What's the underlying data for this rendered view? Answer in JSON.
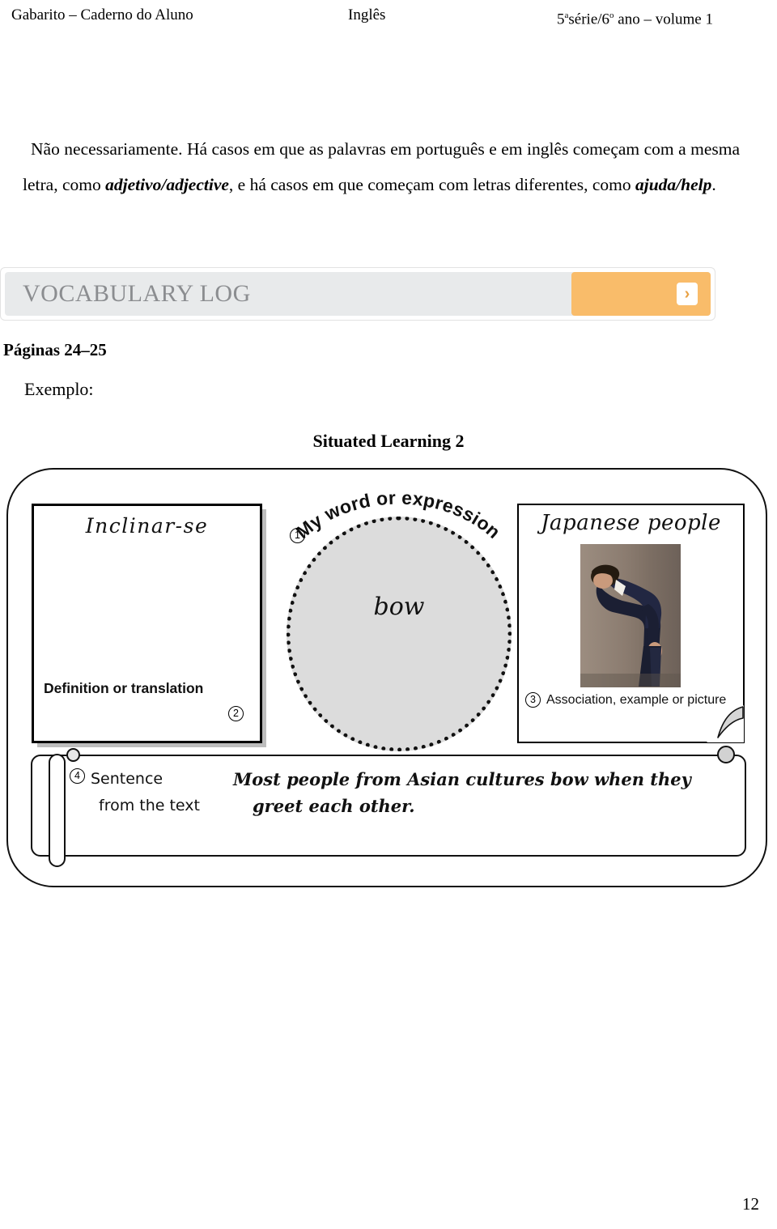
{
  "header": {
    "left": "Gabarito – Caderno do Aluno",
    "center": "Inglês",
    "right_prefix": "5",
    "right_sup1": "a",
    "right_mid": "série/6",
    "right_sup2": "o",
    "right_suffix": " ano – volume 1"
  },
  "body": {
    "paragraph_part1": "Não necessariamente. Há casos em que as palavras em português e em inglês começam com a mesma letra, como ",
    "paragraph_emph1": "adjetivo/adjective",
    "paragraph_part2": ", e há casos em que começam com letras diferentes, como ",
    "paragraph_emph2": "ajuda/help",
    "paragraph_part3": "."
  },
  "vocab_banner": {
    "title": "VOCABULARY LOG",
    "chevron_glyph": "›",
    "bg_color": "#e8eaeb",
    "button_color": "#f9bc6a",
    "title_color": "#8b8d90"
  },
  "section": {
    "paginas": "Páginas 24–25",
    "exemplo": "Exemplo:",
    "situated_title": "Situated Learning 2"
  },
  "diagram": {
    "definition": {
      "word": "Inclinar-se",
      "caption": "Definition or translation",
      "number": "2"
    },
    "word_circle": {
      "arc_label": "My word or expression",
      "value": "bow",
      "number": "1",
      "fill_color": "#dcdcdc"
    },
    "association": {
      "word": "Japanese people",
      "caption": "Association, example or picture",
      "number": "3",
      "photo_alt": "bowing-man-photo"
    },
    "sentence": {
      "number": "4",
      "label_line1": "Sentence",
      "label_line2": "from the text",
      "text_line1": "Most people from Asian cultures bow when they",
      "text_line2": "greet each other."
    }
  },
  "footer": {
    "page_number": "12"
  }
}
